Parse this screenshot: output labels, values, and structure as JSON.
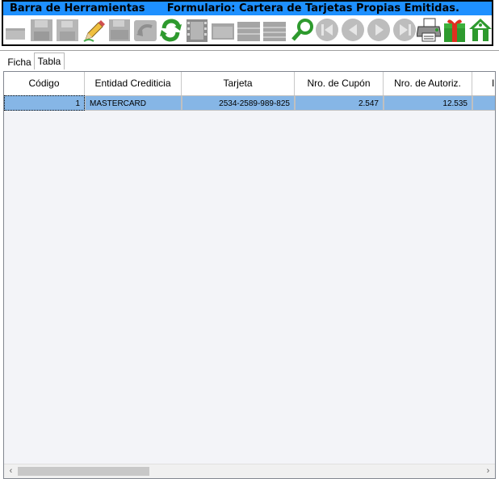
{
  "toolbar": {
    "title": "Barra de Herramientas      Formulario: Cartera de Tarjetas Propias Emitidas.",
    "buttons": [
      {
        "icon": "new-icon",
        "enabled": false
      },
      {
        "icon": "save-icon",
        "enabled": false
      },
      {
        "icon": "save-all-icon",
        "enabled": false
      },
      {
        "icon": "edit-pencil-icon",
        "enabled": true
      },
      {
        "icon": "save-as-icon",
        "enabled": false
      },
      {
        "icon": "undo-icon",
        "enabled": false
      },
      {
        "icon": "refresh-icon",
        "enabled": true
      },
      {
        "icon": "film-icon",
        "enabled": false
      },
      {
        "icon": "window-icon",
        "enabled": false
      },
      {
        "icon": "grid-icon",
        "enabled": false
      },
      {
        "icon": "grid-alt-icon",
        "enabled": false
      },
      {
        "icon": "search-icon",
        "enabled": true
      },
      {
        "icon": "first-record-icon",
        "enabled": false
      },
      {
        "icon": "previous-record-icon",
        "enabled": false
      },
      {
        "icon": "next-record-icon",
        "enabled": false
      },
      {
        "icon": "last-record-icon",
        "enabled": false
      },
      {
        "icon": "printer-icon",
        "enabled": true
      },
      {
        "icon": "gift-icon",
        "enabled": true
      },
      {
        "icon": "home-icon",
        "enabled": true
      }
    ]
  },
  "tabs": {
    "ficha": "Ficha",
    "tabla": "Tabla",
    "active": "Tabla"
  },
  "table": {
    "columns": [
      "Código",
      "Entidad Crediticia",
      "Tarjeta",
      "Nro. de Cupón",
      "Nro. de Autoriz.",
      "I"
    ],
    "rows": [
      {
        "codigo": "1",
        "entidad": "MASTERCARD",
        "tarjeta": "2534-2589-989-825",
        "cupon": "2.547",
        "autorizacion": "12.535"
      }
    ]
  },
  "scrollbar": {
    "left_arrow": "‹",
    "right_arrow": "›"
  },
  "colors": {
    "title_bar": "#1e90ff",
    "selected_row": "#86b6e6",
    "grid_background": "#f3f4f8",
    "green_icon": "#2e9a2e"
  }
}
